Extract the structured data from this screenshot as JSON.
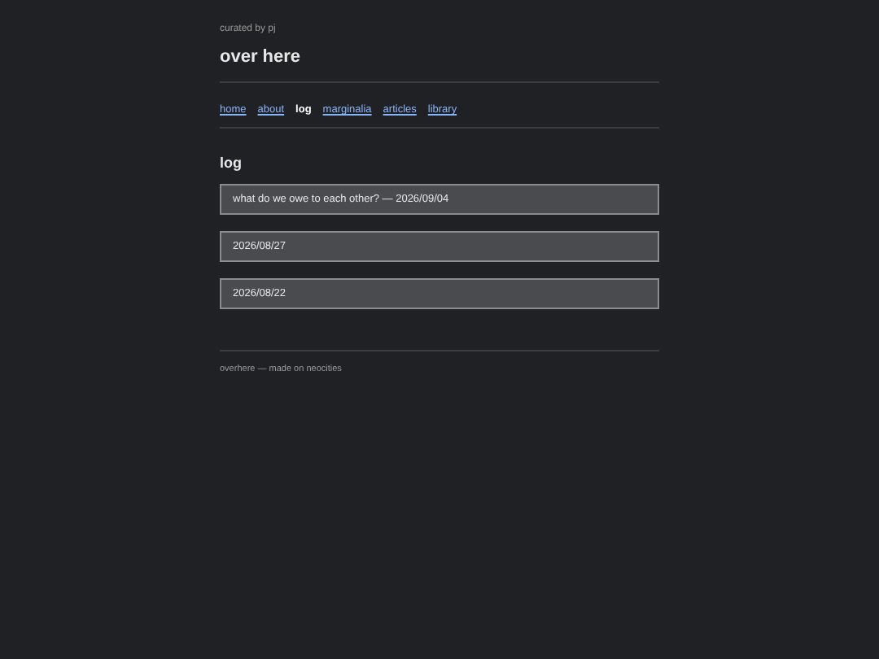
{
  "header": {
    "tagline": "curated by pj",
    "title": "over here"
  },
  "nav": [
    {
      "label": "home",
      "selected": false
    },
    {
      "label": "about",
      "selected": false
    },
    {
      "label": "log",
      "selected": true
    },
    {
      "label": "marginalia",
      "selected": false
    },
    {
      "label": "articles",
      "selected": false
    },
    {
      "label": "library",
      "selected": false
    }
  ],
  "section": {
    "heading": "log",
    "entries": [
      {
        "label": "what do we owe to each other? — 2026/09/04"
      },
      {
        "label": "2026/08/27"
      },
      {
        "label": "2026/08/22"
      }
    ]
  },
  "footer": "overhere — made on neocities"
}
